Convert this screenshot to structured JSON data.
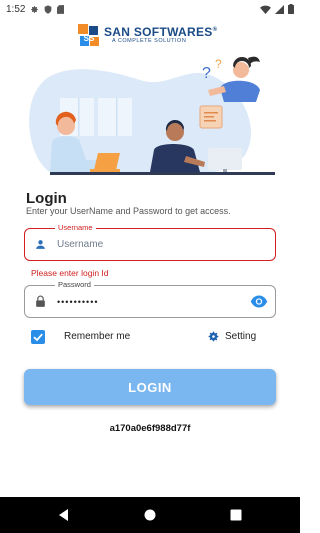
{
  "status_bar": {
    "time": "1:52",
    "icons": [
      "settings-icon",
      "shield-icon",
      "sd-card-icon",
      "wifi-icon",
      "signal-icon",
      "battery-icon"
    ]
  },
  "logo": {
    "title": "SAN SOFTWARES",
    "registered": "®",
    "subtitle": "A COMPLETE SOLUTION",
    "mark_text": "SS"
  },
  "login": {
    "title": "Login",
    "subtitle": "Enter your UserName and Password to get access."
  },
  "username_field": {
    "label": "Username",
    "placeholder": "Username",
    "value": "",
    "error": "Please enter login Id"
  },
  "password_field": {
    "label": "Password",
    "value": "••••••••••"
  },
  "remember_me": {
    "label": "Remember me",
    "checked": true
  },
  "setting": {
    "label": "Setting"
  },
  "login_button": {
    "label": "LOGIN"
  },
  "device_id": "a170a0e6f988d77f",
  "colors": {
    "accent": "#2a8ee8",
    "button": "#7ab6ef",
    "error": "#d21f1f",
    "brand": "#1a4b86"
  }
}
